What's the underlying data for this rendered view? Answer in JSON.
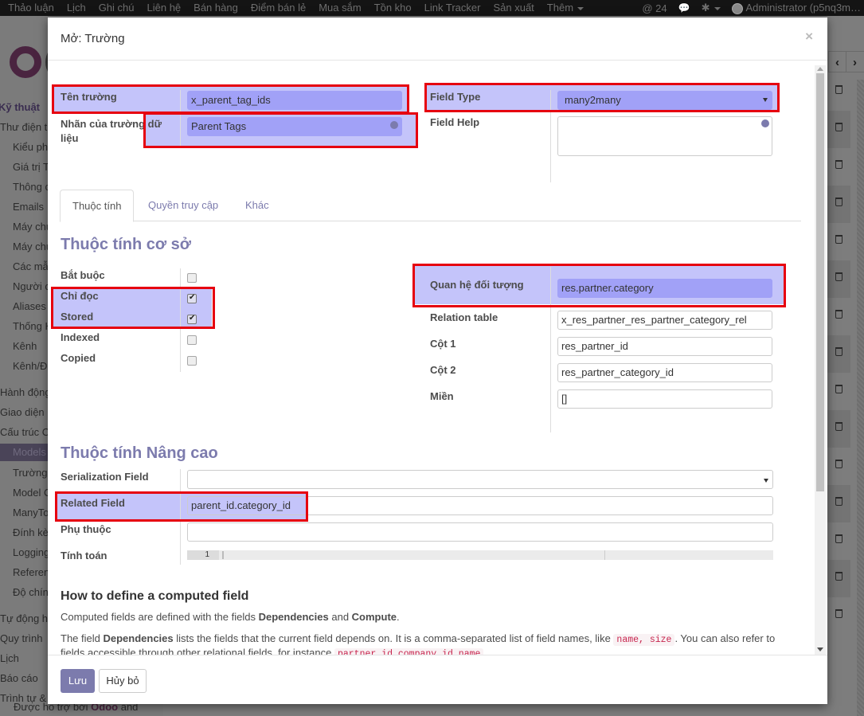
{
  "topnav": {
    "menu": [
      "Thảo luận",
      "Lịch",
      "Ghi chú",
      "Liên hệ",
      "Bán hàng",
      "Điểm bán lẻ",
      "Mua sắm",
      "Tồn kho",
      "Link Tracker",
      "Sản xuất",
      "Thêm"
    ],
    "mentions_count": "@ 24",
    "user": "Administrator (p5nq3m…"
  },
  "sidebar": {
    "section": "Kỹ thuật",
    "items": [
      "Thư điện tử",
      "Kiểu ph",
      "Giá trị T",
      "Thông c",
      "Emails",
      "Máy chủ",
      "Máy chủ",
      "Các mẫ",
      "Người c",
      "Aliases",
      "Thống K",
      "Kênh",
      "Kênh/Đ",
      "Hành động",
      "Giao diện",
      "Cấu trúc C",
      "Models",
      "Trường",
      "Model C",
      "ManyTo",
      "Đính kè",
      "Logging",
      "Referen",
      "Độ chín",
      "Tự động h",
      "Quy trình",
      "Lịch",
      "Báo cáo",
      "Trình tự &"
    ],
    "footer_prefix": "Được hỗ trợ bởi",
    "footer_brand": "Odoo",
    "footer_suffix": "and"
  },
  "modal": {
    "title": "Mở: Trường",
    "close_label": "×",
    "fields": {
      "field_name_label": "Tên trường",
      "field_name_value": "x_parent_tag_ids",
      "field_label_label": "Nhãn của trường dữ liệu",
      "field_label_value": "Parent Tags",
      "field_type_label": "Field Type",
      "field_type_value": "many2many",
      "field_help_label": "Field Help",
      "field_help_value": ""
    },
    "tabs": [
      "Thuộc tính",
      "Quyền truy cập",
      "Khác"
    ],
    "active_tab": 0,
    "base_section": {
      "title": "Thuộc tính cơ sở",
      "checkboxes": [
        {
          "label": "Bắt buộc",
          "checked": false
        },
        {
          "label": "Chỉ đọc",
          "checked": true
        },
        {
          "label": "Stored",
          "checked": true
        },
        {
          "label": "Indexed",
          "checked": false
        },
        {
          "label": "Copied",
          "checked": false
        }
      ],
      "relation_label": "Quan hệ đối tượng",
      "relation_value": "res.partner.category",
      "relation_table_label": "Relation table",
      "relation_table_value": "x_res_partner_res_partner_category_rel",
      "column1_label": "Cột 1",
      "column1_value": "res_partner_id",
      "column2_label": "Cột 2",
      "column2_value": "res_partner_category_id",
      "domain_label": "Miền",
      "domain_value": "[]"
    },
    "advanced_section": {
      "title": "Thuộc tính Nâng cao",
      "serialization_label": "Serialization Field",
      "serialization_value": "",
      "related_label": "Related Field",
      "related_value": "parent_id.category_id",
      "depends_label": "Phụ thuộc",
      "depends_value": "",
      "compute_label": "Tính toán",
      "compute_line_number": "1"
    },
    "help": {
      "title": "How to define a computed field",
      "p1_a": "Computed fields are defined with the fields ",
      "p1_b": "Dependencies",
      "p1_c": " and ",
      "p1_d": "Compute",
      "p1_e": ".",
      "p2_a": "The field ",
      "p2_b": "Dependencies",
      "p2_c": " lists the fields that the current field depends on. It is a comma-separated list of field names, like ",
      "p2_code1": "name, size",
      "p2_d": ". You can also refer to",
      "p3_a": "fields accessible through other relational fields, for instance ",
      "p3_code": "partner_id.company_id.name",
      "p3_b": "."
    },
    "footer": {
      "save_label": "Lưu",
      "cancel_label": "Hủy bỏ"
    }
  },
  "colors": {
    "accent": "#7c7bad",
    "highlight_bg": "#c4c4fa",
    "highlight_input": "#a1a1f7",
    "annotation_red": "#e6000f"
  }
}
